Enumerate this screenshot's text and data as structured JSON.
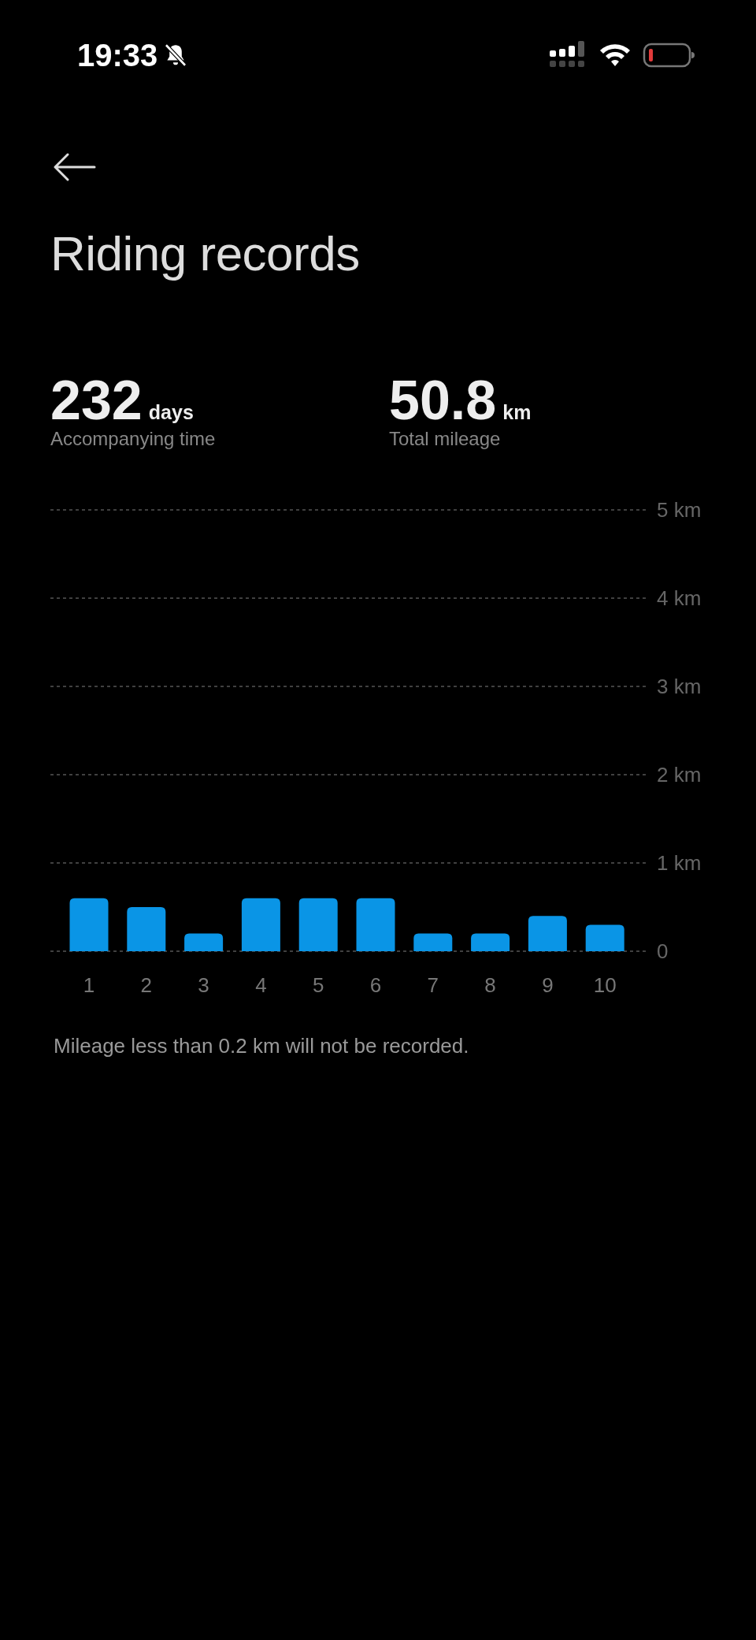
{
  "status_bar": {
    "time": "19:33"
  },
  "title": "Riding records",
  "stats": [
    {
      "value": "232",
      "unit": "days",
      "label": "Accompanying time"
    },
    {
      "value": "50.8",
      "unit": "km",
      "label": "Total mileage"
    }
  ],
  "chart_data": {
    "type": "bar",
    "categories": [
      "1",
      "2",
      "3",
      "4",
      "5",
      "6",
      "7",
      "8",
      "9",
      "10"
    ],
    "grid": true,
    "series": [
      {
        "color": "#0a95e6",
        "values": [
          0.6,
          0.5,
          0.2,
          0.6,
          0.6,
          0.6,
          0.2,
          0.2,
          0.4,
          0.3
        ]
      }
    ],
    "ylim": [
      0,
      5
    ],
    "yticks": [
      {
        "value": 0,
        "label": "0"
      },
      {
        "value": 1,
        "label": "1 km"
      },
      {
        "value": 2,
        "label": "2 km"
      },
      {
        "value": 3,
        "label": "3 km"
      },
      {
        "value": 4,
        "label": "4 km"
      },
      {
        "value": 5,
        "label": "5 km"
      }
    ]
  },
  "note": "Mileage less than 0.2 km will not be recorded."
}
